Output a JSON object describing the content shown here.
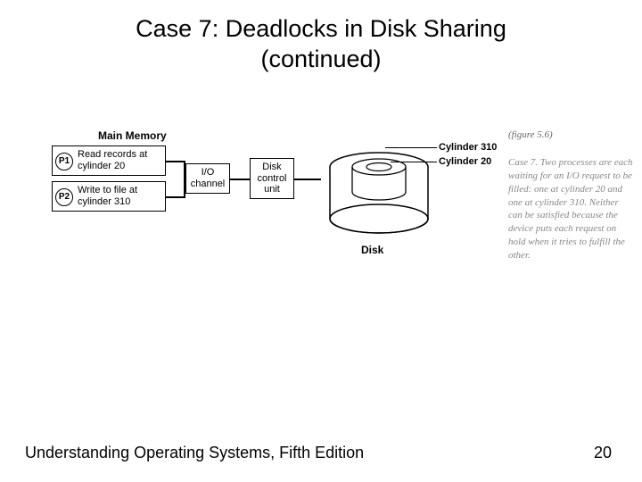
{
  "title_line1": "Case 7: Deadlocks in Disk Sharing",
  "title_line2": "(continued)",
  "diagram": {
    "main_memory_label": "Main Memory",
    "p1_id": "P1",
    "p1_text": "Read records at cylinder 20",
    "p2_id": "P2",
    "p2_text": "Write to file at cylinder 310",
    "io_channel": "I/O channel",
    "disk_control_unit": "Disk control unit",
    "disk_label": "Disk",
    "cyl310": "Cylinder 310",
    "cyl20": "Cylinder 20"
  },
  "figure_ref": "(figure 5.6)",
  "caption": "Case 7. Two processes are each waiting for an I/O request to be filled: one at cylinder 20 and one at cylinder 310. Neither can be satisfied because the device puts each request on hold when it tries to fulfill the other.",
  "footer": {
    "book": "Understanding Operating Systems, Fifth Edition",
    "page": "20"
  }
}
